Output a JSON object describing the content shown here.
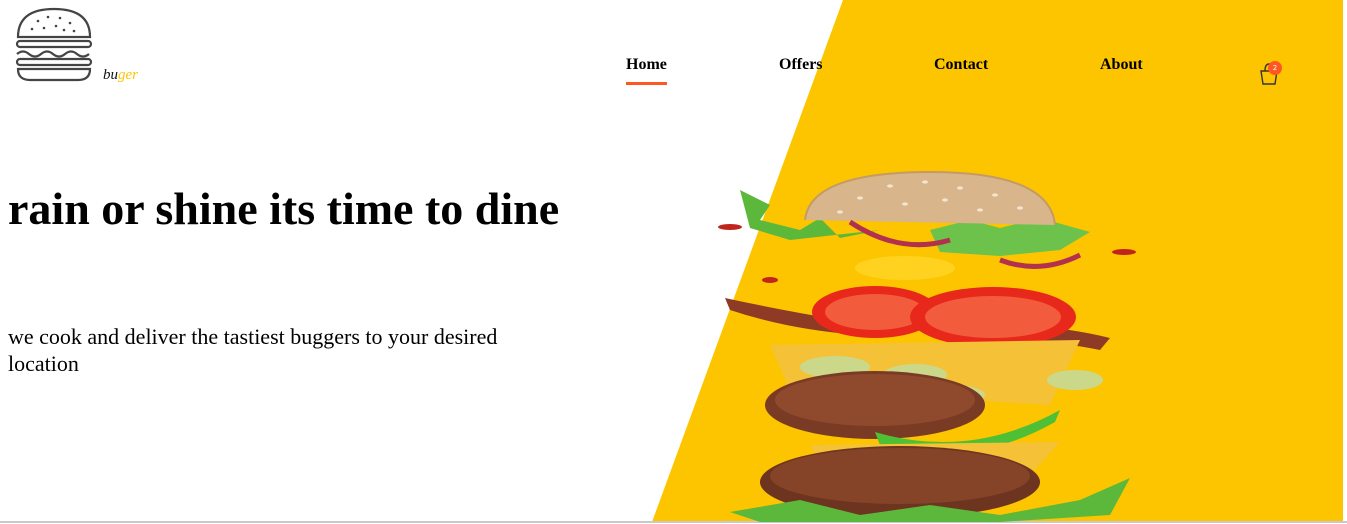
{
  "brand": {
    "name_prefix": "bu",
    "name_accent": "ger"
  },
  "nav": {
    "items": [
      {
        "label": "Home",
        "active": true
      },
      {
        "label": "Offers",
        "active": false
      },
      {
        "label": "Contact",
        "active": false
      },
      {
        "label": "About",
        "active": false
      }
    ]
  },
  "cart": {
    "icon": "shopping-bag-icon",
    "count": "2"
  },
  "hero": {
    "title": "rain or shine its time to dine",
    "subtitle": "we cook and deliver the tastiest buggers to your desired location",
    "image": "stacked-burger-illustration"
  },
  "colors": {
    "accent": "#ffc300",
    "active": "#ff5722",
    "text": "#000000"
  }
}
